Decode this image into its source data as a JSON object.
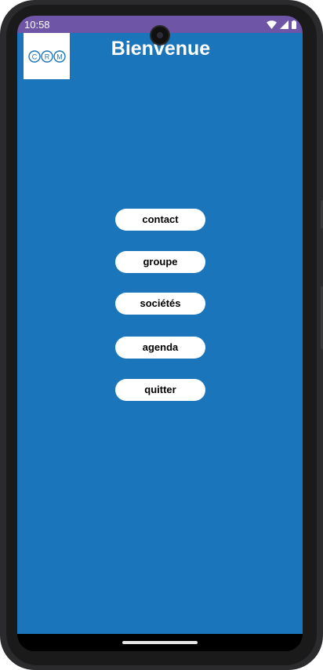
{
  "status_bar": {
    "time": "10:58",
    "icons": [
      "wifi-icon",
      "signal-icon",
      "battery-icon"
    ],
    "color": "#6e55a6"
  },
  "app": {
    "background_color": "#1b75bb",
    "logo_text": "CRM",
    "title": "Bienvenue"
  },
  "menu": {
    "items": [
      {
        "label": "contact"
      },
      {
        "label": "groupe"
      },
      {
        "label": "sociétés"
      },
      {
        "label": "agenda"
      },
      {
        "label": "quitter"
      }
    ]
  }
}
